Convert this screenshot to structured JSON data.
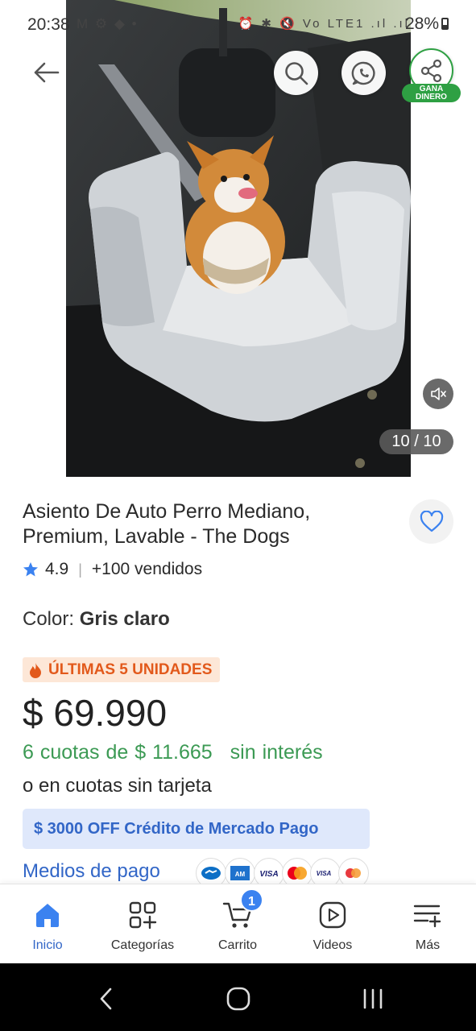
{
  "status_bar": {
    "time": "20:38",
    "battery": "28%",
    "left_icons": "M ⚙ ◆ •",
    "right_icons": "⏰ ✱ 🔇 Vo LTE1 .ıl .ıl"
  },
  "gallery": {
    "counter": "10 / 10",
    "share_badge_line1": "GANA",
    "share_badge_line2": "DINERO",
    "icons": [
      "back-arrow-icon",
      "search-icon",
      "whatsapp-icon",
      "share-icon",
      "mute-icon"
    ]
  },
  "product": {
    "title": "Asiento De Auto Perro Mediano, Premium, Lavable - The Dogs",
    "rating": "4.9",
    "rating_sep": "|",
    "sold": "+100 vendidos",
    "color_label": "Color: ",
    "color_value": "Gris claro",
    "stock_badge": "ÚLTIMAS 5 UNIDADES",
    "price": "$ 69.990",
    "installments_a": "6 cuotas de $ 11.665",
    "installments_b": "sin interés",
    "no_card": "o en cuotas sin tarjeta",
    "credit_banner": "$ 3000 OFF Crédito de Mercado Pago",
    "payment_link": "Medios de pago",
    "payment_icons": [
      "handshake-icon",
      "amex-icon",
      "visa-icon",
      "mastercard-icon",
      "visa-debit-icon",
      "maestro-icon"
    ]
  },
  "bottom_nav": {
    "items": [
      {
        "label": "Inicio",
        "icon": "home-icon"
      },
      {
        "label": "Categorías",
        "icon": "categories-icon"
      },
      {
        "label": "Carrito",
        "icon": "cart-icon",
        "badge": "1"
      },
      {
        "label": "Videos",
        "icon": "play-icon"
      },
      {
        "label": "Más",
        "icon": "menu-plus-icon"
      }
    ],
    "active_color": "#3266c7"
  },
  "colors": {
    "accent_blue": "#3266c7",
    "green": "#3c9a54",
    "orange": "#e2591b"
  }
}
